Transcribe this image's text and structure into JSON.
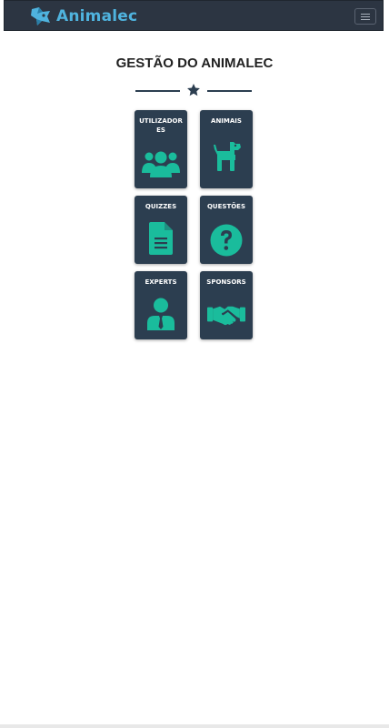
{
  "navbar": {
    "brand_name": "Animalec",
    "brand_color": "#4fb3de",
    "toggle_icon": "hamburger-icon",
    "background": "#2c3542"
  },
  "page": {
    "title": "GESTÃO DO ANIMALEC",
    "divider_icon": "star-icon"
  },
  "cards": [
    {
      "label": "UTILIZADORES",
      "icon": "users-icon"
    },
    {
      "label": "ANIMAIS",
      "icon": "dog-icon"
    },
    {
      "label": "QUIZZES",
      "icon": "document-icon"
    },
    {
      "label": "QUESTÕES",
      "icon": "question-circle-icon"
    },
    {
      "label": "EXPERTS",
      "icon": "user-tie-icon"
    },
    {
      "label": "SPONSORS",
      "icon": "handshake-icon"
    }
  ],
  "colors": {
    "card_background": "#2c3e50",
    "icon_accent": "#1abc9c",
    "card_text": "#ffffff"
  }
}
